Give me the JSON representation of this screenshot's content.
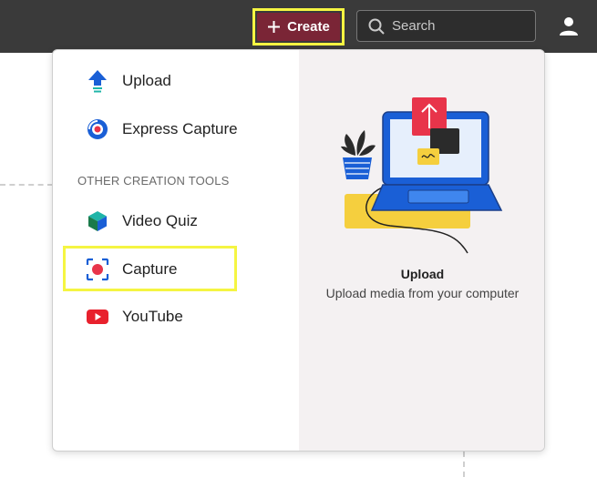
{
  "header": {
    "create_label": "Create",
    "search_placeholder": "Search"
  },
  "menu": {
    "primary": [
      {
        "label": "Upload",
        "icon": "upload-icon"
      },
      {
        "label": "Express Capture",
        "icon": "express-capture-icon"
      }
    ],
    "section_label": "OTHER CREATION TOOLS",
    "other": [
      {
        "label": "Video Quiz",
        "icon": "video-quiz-icon"
      },
      {
        "label": "Capture",
        "icon": "capture-icon"
      },
      {
        "label": "YouTube",
        "icon": "youtube-icon"
      }
    ]
  },
  "preview": {
    "title": "Upload",
    "subtitle": "Upload media from your computer"
  },
  "colors": {
    "topbar": "#3a3a3a",
    "create_button": "#7a2536",
    "highlight": "#f5f542",
    "preview_bg": "#f4f1f2"
  }
}
